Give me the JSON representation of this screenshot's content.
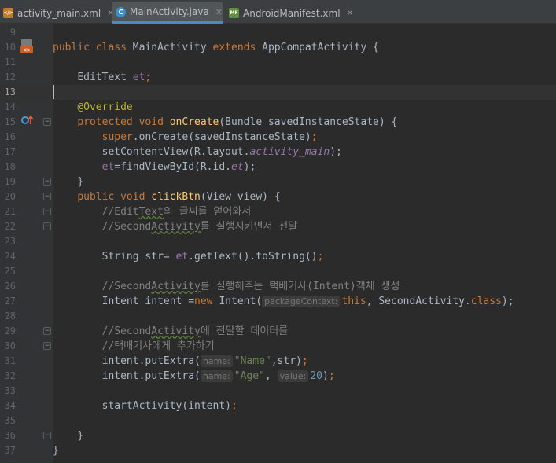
{
  "tabs": [
    {
      "label": "activity_main.xml",
      "icon": "xml-file-icon",
      "icon_text": "</>"
    },
    {
      "label": "MainActivity.java",
      "icon": "java-class-icon",
      "icon_text": "C"
    },
    {
      "label": "AndroidManifest.xml",
      "icon": "manifest-file-icon",
      "icon_text": "MF"
    }
  ],
  "active_tab": "MainActivity.java",
  "current_line": "13",
  "lines": [
    {
      "num": "9"
    },
    {
      "num": "10"
    },
    {
      "num": "11"
    },
    {
      "num": "12"
    },
    {
      "num": "13"
    },
    {
      "num": "14"
    },
    {
      "num": "15"
    },
    {
      "num": "16"
    },
    {
      "num": "17"
    },
    {
      "num": "18"
    },
    {
      "num": "19"
    },
    {
      "num": "20"
    },
    {
      "num": "21"
    },
    {
      "num": "22"
    },
    {
      "num": "23"
    },
    {
      "num": "24"
    },
    {
      "num": "25"
    },
    {
      "num": "26"
    },
    {
      "num": "27"
    },
    {
      "num": "28"
    },
    {
      "num": "29"
    },
    {
      "num": "30"
    },
    {
      "num": "31"
    },
    {
      "num": "32"
    },
    {
      "num": "33"
    },
    {
      "num": "34"
    },
    {
      "num": "35"
    },
    {
      "num": "36"
    },
    {
      "num": "37"
    }
  ],
  "code": {
    "l10": {
      "kw_public": "public",
      "kw_class": "class",
      "class_name": "MainActivity",
      "kw_extends": "extends",
      "parent": "AppCompatActivity",
      "brace": "{"
    },
    "l12": {
      "type": "EditText",
      "field": "et",
      "semi": ";"
    },
    "l14": {
      "annotation": "@Override"
    },
    "l15": {
      "kw_protected": "protected",
      "kw_void": "void",
      "method": "onCreate",
      "params": "(Bundle savedInstanceState) {"
    },
    "l16": {
      "kw_super": "super",
      "rest": ".onCreate(savedInstanceState)",
      "semi": ";"
    },
    "l17": {
      "call": "setContentView(R.layout.",
      "ref": "activity_main",
      "end": ");"
    },
    "l18": {
      "field": "et",
      "mid": "=findViewById(R.id.",
      "ref": "et",
      "end": ");"
    },
    "l19": {
      "text": "}"
    },
    "l20": {
      "kw_public": "public",
      "kw_void": "void",
      "method": "clickBtn",
      "params": "(View view) {"
    },
    "l21": {
      "pre": "//Edit",
      "typo": "Text",
      "post": "의 글씨를 얻어와서"
    },
    "l22": {
      "pre": "//Second",
      "typo": "Activity",
      "post": "를 실행시키면서 전달"
    },
    "l24": {
      "pre": "String str= ",
      "field": "et",
      "post": ".getText().toString()",
      "semi": ";"
    },
    "l26": {
      "pre": "//Second",
      "typo": "Activity",
      "post": "를 실행해주는 택배기사(Intent)객체 생성"
    },
    "l27": {
      "pre": "Intent intent =",
      "kw_new": "new",
      "post1": " Intent(",
      "hint": "packageContext:",
      "kw_this": "this",
      "mid": ", SecondActivity.",
      "kw_class": "class",
      "end": ");"
    },
    "l29": {
      "pre": "//Second",
      "typo": "Activity",
      "post": "에 전달할 데이터를"
    },
    "l30": {
      "text": "//택배기사에게 추가하기"
    },
    "l31": {
      "pre": "intent.putExtra(",
      "hint": "name:",
      "str": "\"Name\"",
      "post": ",str)",
      "semi": ";"
    },
    "l32": {
      "pre": "intent.putExtra(",
      "hint1": "name:",
      "str": "\"Age\"",
      "comma": ",",
      "hint2": "value:",
      "num": "20",
      "end": ")",
      "semi": ";"
    },
    "l34": {
      "pre": "startActivity(intent)",
      "semi": ";"
    },
    "l36": {
      "text": "}"
    },
    "l37": {
      "text": "}"
    }
  },
  "colors": {
    "background": "#2b2b2b",
    "keyword": "#cc7832",
    "method": "#ffc66d",
    "annotation": "#bbb529",
    "field": "#9876aa",
    "string": "#6a8759",
    "number": "#6897bb",
    "comment": "#808080",
    "text": "#a9b7c6",
    "accent": "#4a88c7"
  }
}
